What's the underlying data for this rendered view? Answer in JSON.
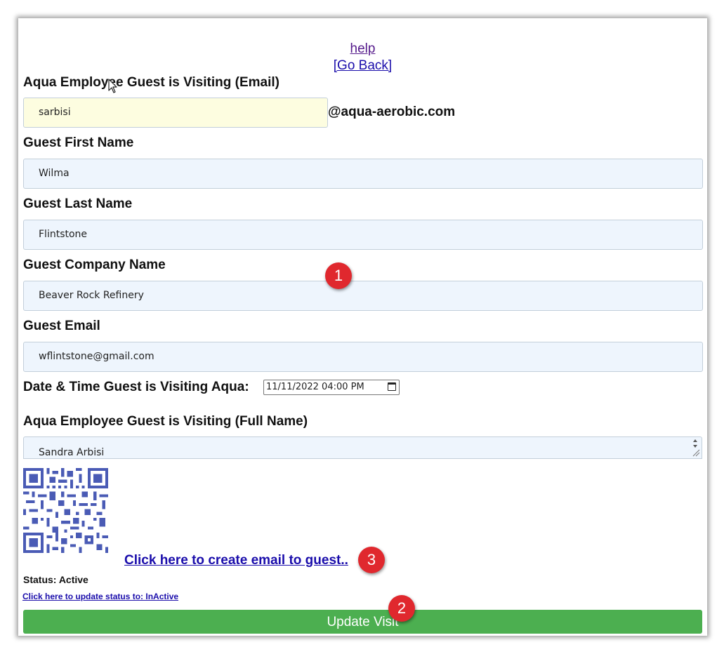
{
  "nav": {
    "help": "help",
    "go_back": "[Go Back]"
  },
  "form": {
    "employee_email": {
      "label": "Aqua Employee Guest is Visiting (Email)",
      "value": "sarbisi",
      "domain": "@aqua-aerobic.com"
    },
    "first_name": {
      "label": "Guest First Name",
      "value": "Wilma"
    },
    "last_name": {
      "label": "Guest Last Name",
      "value": "Flintstone"
    },
    "company": {
      "label": "Guest Company Name",
      "value": "Beaver Rock Refinery"
    },
    "guest_email": {
      "label": "Guest Email",
      "value": "wflintstone@gmail.com"
    },
    "visit_datetime": {
      "label": "Date & Time Guest is Visiting Aqua:",
      "value": "11/11/2022 04:00 PM"
    },
    "employee_full_name": {
      "label": "Aqua Employee Guest is Visiting (Full Name)",
      "value": "Sandra Arbisi"
    }
  },
  "actions": {
    "create_email": "Click here to create email to guest..",
    "status": "Status: Active",
    "update_status": "Click here to update status to: InActive",
    "update_visit": "Update Visit"
  },
  "annotations": {
    "one": "1",
    "two": "2",
    "three": "3"
  },
  "colors": {
    "button_green": "#4caf50",
    "badge_red": "#e0282e",
    "qr_blue": "#4a5bb5",
    "input_bg": "#eef5fd",
    "input_highlight": "#fdfde0"
  },
  "icons": [
    "calendar-icon",
    "cursor-arrow-icon",
    "qr-code",
    "resize-handle-icon"
  ]
}
